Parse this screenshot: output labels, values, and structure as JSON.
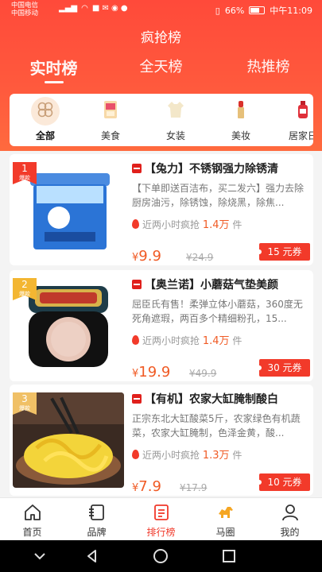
{
  "status_bar": {
    "carrier_1": "中国电信",
    "carrier_2": "中国移动",
    "battery": "66%",
    "time": "中午11:09"
  },
  "page_title": "疯抢榜",
  "tabs": [
    {
      "label": "实时榜",
      "active": true
    },
    {
      "label": "全天榜",
      "active": false
    },
    {
      "label": "热推榜",
      "active": false
    }
  ],
  "categories": [
    {
      "label": "全部",
      "icon": "all-grid-icon",
      "active": true
    },
    {
      "label": "美食",
      "icon": "food-icon",
      "active": false
    },
    {
      "label": "女装",
      "icon": "womens-clothing-icon",
      "active": false
    },
    {
      "label": "美妆",
      "icon": "cosmetics-icon",
      "active": false
    },
    {
      "label": "居家日",
      "icon": "household-icon",
      "active": false
    }
  ],
  "products": [
    {
      "rank": "1",
      "badge": "爆款",
      "title": "【兔力】不锈钢强力除锈清",
      "description": "【下单即送百洁布，买二发六】强力去除厨房油污，除锈蚀，除烧黑，除焦...",
      "hot_label": "近两小时疯抢",
      "hot_count": "1.4万",
      "hot_unit": "件",
      "price_symbol": "¥",
      "price": "9.9",
      "original_price": "¥24.9",
      "coupon": "15 元券",
      "image": "rust-remover-tub"
    },
    {
      "rank": "2",
      "badge": "爆款",
      "title": "【奥兰诺】小蘑菇气垫美颜",
      "description": "屈臣氏有售！柔弹立体小蘑菇，360度无死角遮瑕，两百多个精细粉孔，15...",
      "hot_label": "近两小时疯抢",
      "hot_count": "1.4万",
      "hot_unit": "件",
      "price_symbol": "¥",
      "price": "19.9",
      "original_price": "¥49.9",
      "coupon": "30 元券",
      "image": "cushion-compact"
    },
    {
      "rank": "3",
      "badge": "爆款",
      "title": "【有机】农家大缸腌制酸白",
      "description": "正宗东北大缸酸菜5斤，农家绿色有机蔬菜，农家大缸腌制，色泽金黄，酸...",
      "hot_label": "近两小时疯抢",
      "hot_count": "1.3万",
      "hot_unit": "件",
      "price_symbol": "¥",
      "price": "7.9",
      "original_price": "¥17.9",
      "coupon": "10 元券",
      "image": "pickled-cabbage-bowl"
    }
  ],
  "tab_bar": [
    {
      "label": "首页",
      "icon": "home-icon",
      "active": false
    },
    {
      "label": "品牌",
      "icon": "brand-icon",
      "active": false
    },
    {
      "label": "排行榜",
      "icon": "ranking-icon",
      "active": true
    },
    {
      "label": "马圈",
      "icon": "horse-icon",
      "active": false
    },
    {
      "label": "我的",
      "icon": "profile-icon",
      "active": false
    }
  ],
  "colors": {
    "header_red": "#ff4a3a",
    "accent_orange": "#f05a24",
    "coupon_red": "#f23a2a"
  }
}
